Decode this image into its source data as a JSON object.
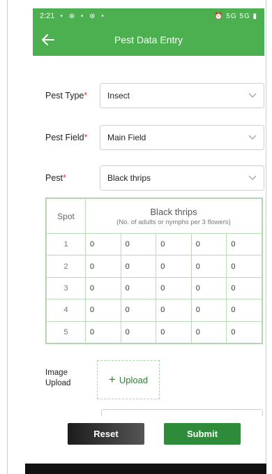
{
  "status_bar": {
    "time": "2:21",
    "notification_icons": "• ⊛ • ⊛ •",
    "system_icons": "⏰ 5G 5G ▮"
  },
  "app_bar": {
    "title": "Pest Data Entry",
    "back_icon": "arrow-left-icon"
  },
  "form": {
    "pest_type": {
      "label": "Pest Type",
      "required": "*",
      "value": "Insect"
    },
    "pest_field": {
      "label": "Pest Field",
      "required": "*",
      "value": "Main Field"
    },
    "pest": {
      "label": "Pest",
      "required": "*",
      "value": "Black thrips"
    }
  },
  "table": {
    "spot_header": "Spot",
    "title": "Black thrips",
    "subtitle": "(No. of adults or nymphs per 3 flowers)",
    "rows": [
      {
        "spot": "1",
        "values": [
          "0",
          "0",
          "0",
          "0",
          "0"
        ]
      },
      {
        "spot": "2",
        "values": [
          "0",
          "0",
          "0",
          "0",
          "0"
        ]
      },
      {
        "spot": "3",
        "values": [
          "0",
          "0",
          "0",
          "0",
          "0"
        ]
      },
      {
        "spot": "4",
        "values": [
          "0",
          "0",
          "0",
          "0",
          "0"
        ]
      },
      {
        "spot": "5",
        "values": [
          "0",
          "0",
          "0",
          "0",
          "0"
        ]
      }
    ]
  },
  "upload": {
    "label_line1": "Image",
    "label_line2": "Upload",
    "button_plus": "+",
    "button_text": "Upload"
  },
  "actions": {
    "reset": "Reset",
    "submit": "Submit"
  },
  "colors": {
    "primary_green": "#4caf50",
    "submit_green": "#2e8b3a",
    "required_red": "#e53935"
  }
}
